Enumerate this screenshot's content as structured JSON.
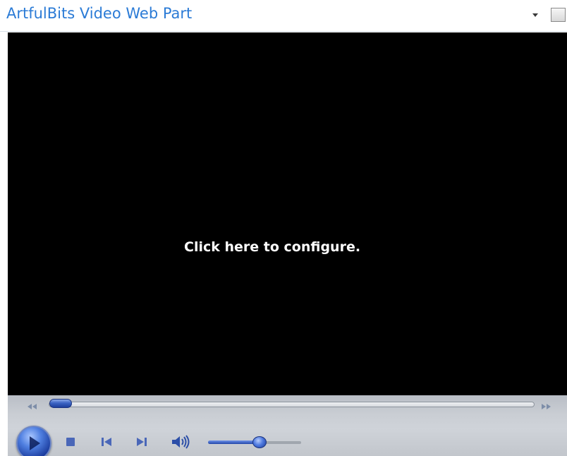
{
  "header": {
    "title": "ArtfulBits Video Web Part",
    "menu_icon": "dropdown-arrow-icon",
    "select_icon": "checkbox-icon"
  },
  "player": {
    "placeholder_text": "Click here to configure.",
    "seek_position": 0.0,
    "volume_level": 0.55,
    "controls": {
      "play_icon": "play-icon",
      "stop_icon": "stop-icon",
      "previous_icon": "previous-track-icon",
      "next_icon": "next-track-icon",
      "volume_icon": "volume-speaker-icon",
      "rewind_icon": "rewind-icon",
      "fast_forward_icon": "fast-forward-icon"
    }
  },
  "colors": {
    "title": "#2b7bd6",
    "video_background": "#000000",
    "accent": "#2246a8"
  }
}
